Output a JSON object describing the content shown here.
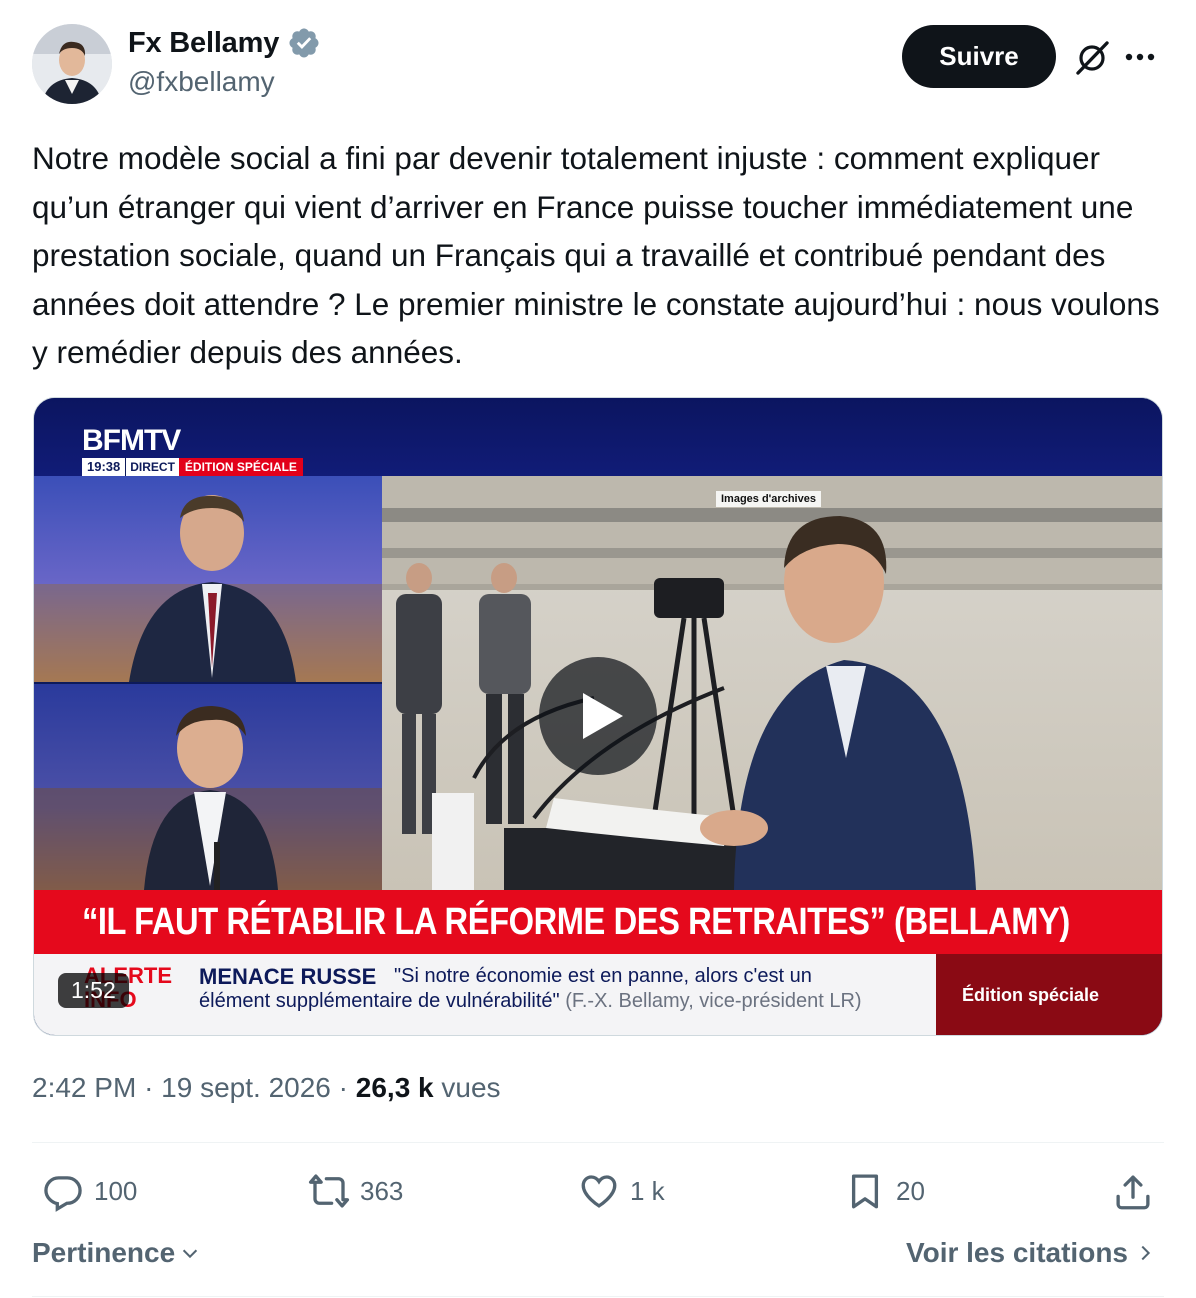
{
  "author": {
    "display_name": "Fx Bellamy",
    "handle": "@fxbellamy",
    "verified_icon": "verified-badge-icon",
    "verified_color": "#829aab"
  },
  "header": {
    "follow_label": "Suivre",
    "grok_icon": "grok-icon",
    "more_icon": "more-icon"
  },
  "tweet": {
    "text": "Notre modèle social a fini par devenir totalement injuste : comment expliquer qu’un étranger qui vient d’arriver en France puisse toucher immédiatement une prestation sociale, quand un Français qui a travaillé et contribué pendant des années doit attendre ? Le premier ministre le constate aujourd’hui : nous voulons y remédier depuis des années."
  },
  "media": {
    "channel": "BFMTV",
    "time": "19:38",
    "direct": "DIRECT",
    "edition": "ÉDITION SPÉCIALE",
    "archives_tag": "Images d'archives",
    "headline": "“IL FAUT RÉTABLIR LA RÉFORME DES RETRAITES” (BELLAMY)",
    "alert_label": "ALERTE INFO",
    "ticker_topic": "MENACE RUSSE",
    "ticker_quote_line1": "\"Si notre économie est en panne, alors c'est un",
    "ticker_quote_line2": "élément supplémentaire de vulnérabilité\"",
    "ticker_attribution": "(F.-X. Bellamy, vice-président LR)",
    "special_box": "Édition spéciale",
    "duration": "1:52",
    "headline_color": "#e5091c"
  },
  "meta": {
    "time": "2:42 PM",
    "separator": "·",
    "date": "19 sept. 2026",
    "views_count": "26,3 k",
    "views_label": "vues"
  },
  "actions": {
    "replies": "100",
    "reposts": "363",
    "likes": "1 k",
    "bookmarks": "20"
  },
  "footer": {
    "sort_label": "Pertinence",
    "quotes_link": "Voir les citations"
  }
}
